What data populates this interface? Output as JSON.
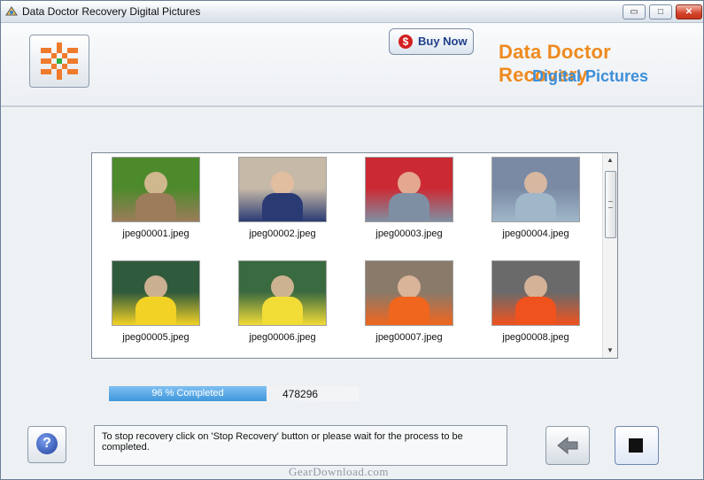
{
  "window": {
    "title": "Data Doctor Recovery Digital Pictures",
    "controls": {
      "minimize": "▭",
      "maximize": "□",
      "close": "✕"
    }
  },
  "header": {
    "buy_now_label": "Buy Now",
    "buy_now_icon_glyph": "$",
    "brand_line1": "Data Doctor Recovery",
    "brand_line2": "Digital Pictures",
    "accent_orange": "#ef8a1f",
    "accent_blue": "#3d8fd8"
  },
  "gallery": {
    "items": [
      {
        "caption": "jpeg00001.jpeg",
        "photo": "two-children-on-grass",
        "colors": [
          "#4d8a2c",
          "#9c7c5a"
        ]
      },
      {
        "caption": "jpeg00002.jpeg",
        "photo": "child-in-doorway",
        "colors": [
          "#c7b9a8",
          "#2a3b74"
        ]
      },
      {
        "caption": "jpeg00003.jpeg",
        "photo": "people-by-red-train",
        "colors": [
          "#cc2a33",
          "#7f8fa3"
        ]
      },
      {
        "caption": "jpeg00004.jpeg",
        "photo": "two-girls-portrait",
        "colors": [
          "#7a8aa4",
          "#a0b6c9"
        ]
      },
      {
        "caption": "jpeg00005.jpeg",
        "photo": "two-boys-red-yellow",
        "colors": [
          "#2f5a3c",
          "#f2d225"
        ]
      },
      {
        "caption": "jpeg00006.jpeg",
        "photo": "boy-in-yellow",
        "colors": [
          "#3a6a40",
          "#f2dc36"
        ]
      },
      {
        "caption": "jpeg00007.jpeg",
        "photo": "child-in-orange-hood",
        "colors": [
          "#8a7a6a",
          "#f0661e"
        ]
      },
      {
        "caption": "jpeg00008.jpeg",
        "photo": "child-in-orange-hood-2",
        "colors": [
          "#6a6a6a",
          "#f0521e"
        ]
      }
    ],
    "scroll": {
      "up": "▲",
      "down": "▼"
    }
  },
  "progress": {
    "percent": 63,
    "label": "96 % Completed",
    "count": "478296",
    "fill_color": "#3f97dc"
  },
  "footer": {
    "help_glyph": "?",
    "message": "To stop recovery click on 'Stop Recovery' button or please wait for the process to be completed.",
    "back_icon": "arrow-left-icon",
    "stop_icon": "stop-square-icon"
  },
  "watermark": "GearDownload.com"
}
